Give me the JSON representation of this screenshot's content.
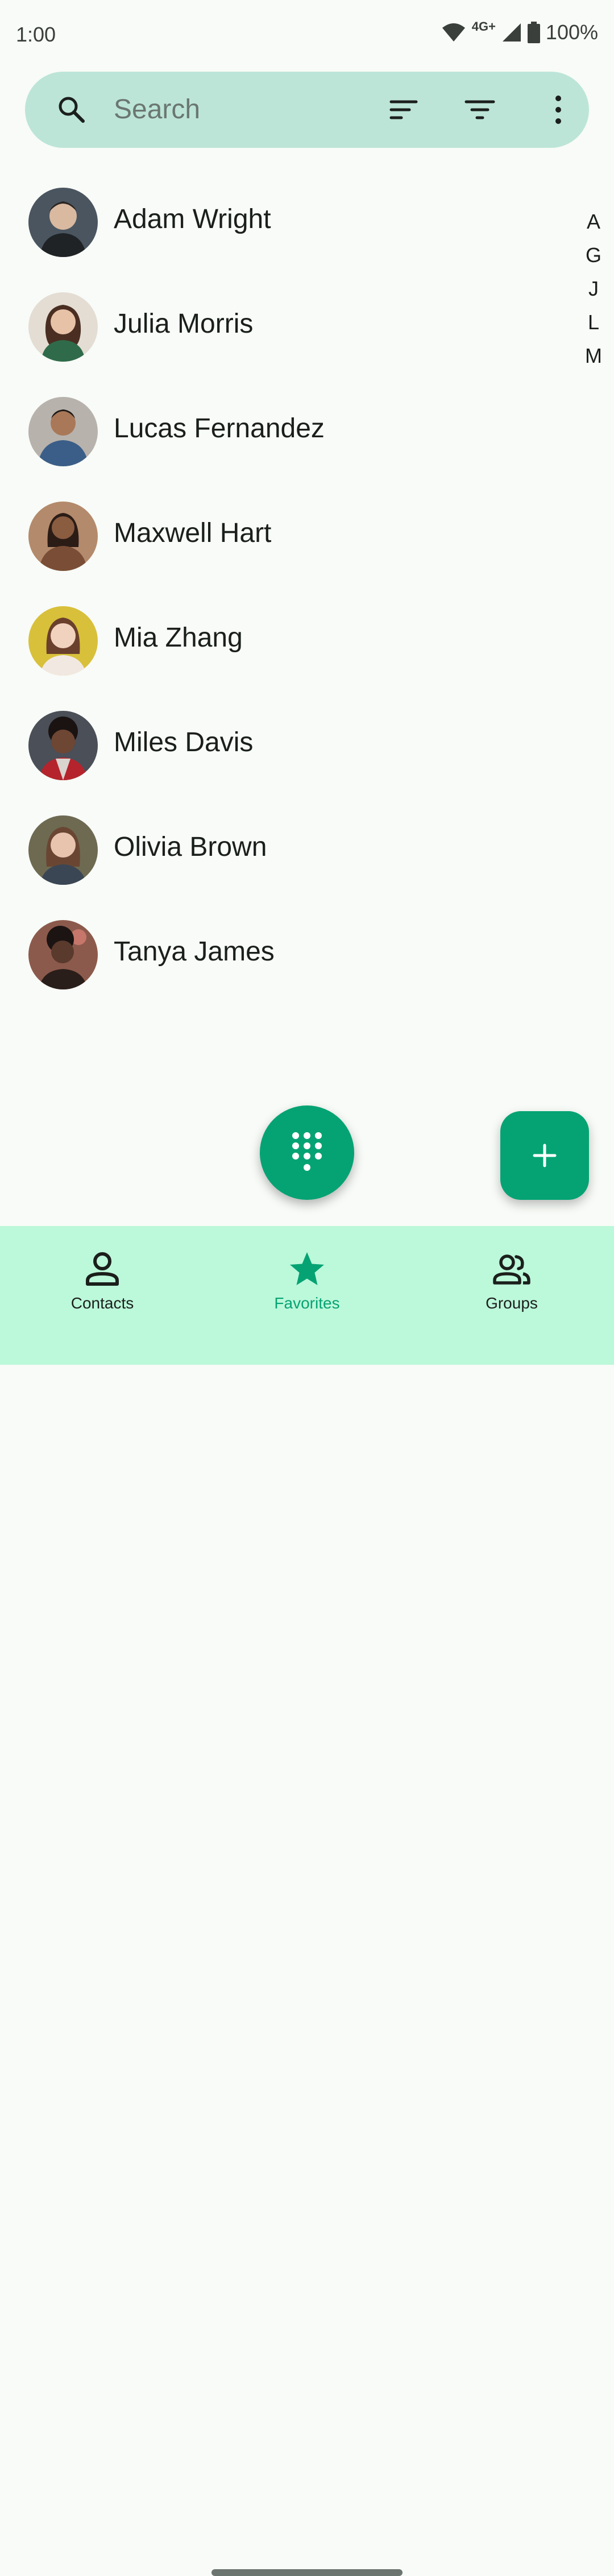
{
  "status_bar": {
    "time": "1:00",
    "network": "4G+",
    "battery": "100%"
  },
  "search": {
    "placeholder": "Search",
    "value": ""
  },
  "contacts": [
    {
      "name": "Adam Wright",
      "avatar_color": "#4a5560"
    },
    {
      "name": "Julia Morris",
      "avatar_color": "#c9b8a6"
    },
    {
      "name": "Lucas Fernandez",
      "avatar_color": "#8d7d73"
    },
    {
      "name": "Maxwell Hart",
      "avatar_color": "#7a5a45"
    },
    {
      "name": "Mia Zhang",
      "avatar_color": "#d8c03a"
    },
    {
      "name": "Miles Davis",
      "avatar_color": "#3a2c2a"
    },
    {
      "name": "Olivia Brown",
      "avatar_color": "#6e6a52"
    },
    {
      "name": "Tanya James",
      "avatar_color": "#5a3a34"
    }
  ],
  "alpha_index": [
    "A",
    "G",
    "J",
    "L",
    "M"
  ],
  "bottom_nav": {
    "contacts_label": "Contacts",
    "favorites_label": "Favorites",
    "groups_label": "Groups"
  },
  "colors": {
    "accent": "#05a373",
    "search_bg": "#bce5d8",
    "nav_bg": "#bcf8da",
    "page_bg": "#f8fbf7"
  }
}
